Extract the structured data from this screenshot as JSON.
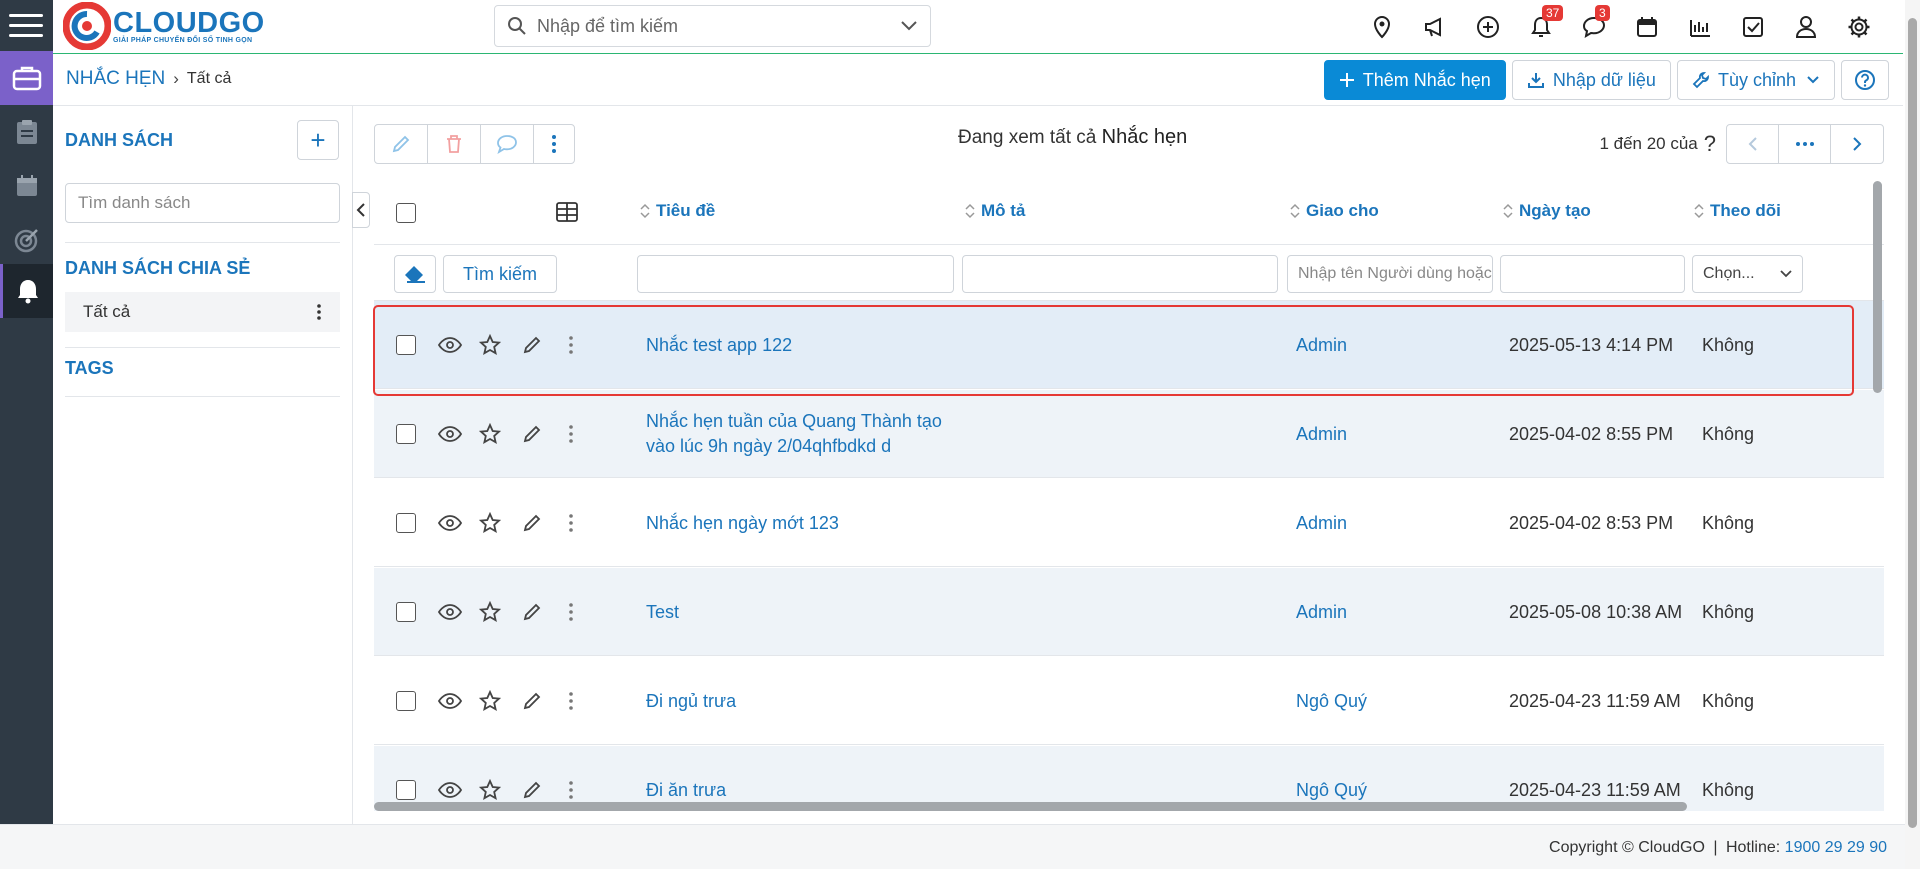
{
  "brand": {
    "name": "CLOUDGO",
    "tagline": "GIẢI PHÁP CHUYỂN ĐỔI SỐ TINH GỌN"
  },
  "search": {
    "placeholder": "Nhập để tìm kiếm"
  },
  "notifications": {
    "bell_count": "37",
    "chat_count": "3"
  },
  "header": {
    "module": "NHẮC HẸN",
    "current": "Tất cả",
    "add_label": "Thêm Nhắc hẹn",
    "import_label": "Nhập dữ liệu",
    "custom_label": "Tùy chỉnh"
  },
  "sidebar": {
    "list_title": "DANH SÁCH",
    "search_placeholder": "Tìm danh sách",
    "shared_title": "DANH SÁCH CHIA SẺ",
    "shared_item": "Tất cả",
    "tags_title": "TAGS"
  },
  "toolbar": {
    "viewing_prefix": "Đang xem tất cả",
    "viewing_module": "Nhắc hẹn",
    "pager_text": "1 đến 20 của",
    "pager_q": "?"
  },
  "table": {
    "columns": [
      "Tiêu đề",
      "Mô tả",
      "Giao cho",
      "Ngày tạo",
      "Theo dõi"
    ],
    "search_button": "Tìm kiếm",
    "assignee_placeholder": "Nhập tên Người dùng hoặc Nhóm",
    "follow_placeholder": "Chọn...",
    "rows": [
      {
        "title": "Nhắc test app 122",
        "assignee": "Admin",
        "created": "2025-05-13 4:14 PM",
        "follow": "Không"
      },
      {
        "title": "Nhắc hẹn tuần của Quang Thành tạo vào lúc 9h ngày 2/04qhfbdkd d",
        "assignee": "Admin",
        "created": "2025-04-02 8:55 PM",
        "follow": "Không"
      },
      {
        "title": "Nhắc hẹn ngày mớt 123",
        "assignee": "Admin",
        "created": "2025-04-02 8:53 PM",
        "follow": "Không"
      },
      {
        "title": "Test",
        "assignee": "Admin",
        "created": "2025-05-08 10:38 AM",
        "follow": "Không"
      },
      {
        "title": "Đi ngủ trưa",
        "assignee": "Ngô Quý",
        "created": "2025-04-23 11:59 AM",
        "follow": "Không"
      },
      {
        "title": "Đi ăn trưa",
        "assignee": "Ngô Quý",
        "created": "2025-04-23 11:59 AM",
        "follow": "Không"
      }
    ]
  },
  "footer": {
    "copyright": "Copyright © CloudGO",
    "hotline_label": "Hotline:",
    "hotline": "1900 29 29 90"
  },
  "colors": {
    "accent": "#1b75bb",
    "primary_button": "#0a8ad6",
    "rail": "#2f3a45",
    "rail_active": "#7b61c9",
    "highlight": "#e53935"
  }
}
